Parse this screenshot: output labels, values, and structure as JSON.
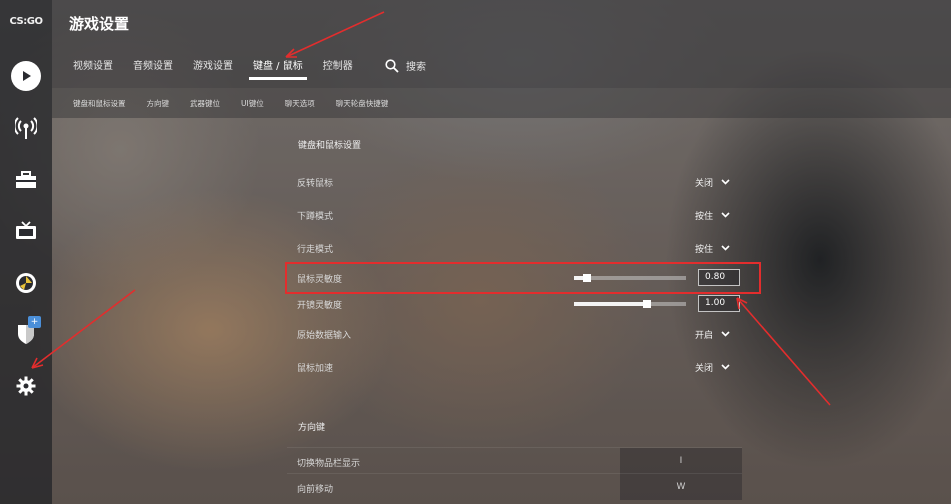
{
  "app": {
    "logo_text": "CS:GO",
    "title": "游戏设置"
  },
  "sidebar": {
    "items": [
      {
        "icon": "play-icon"
      },
      {
        "icon": "broadcast-icon"
      },
      {
        "icon": "briefcase-icon"
      },
      {
        "icon": "tv-icon"
      },
      {
        "icon": "stats-icon"
      },
      {
        "icon": "shield-icon",
        "badge": "+"
      },
      {
        "icon": "gear-icon"
      }
    ]
  },
  "tabs": [
    {
      "label": "视频设置"
    },
    {
      "label": "音频设置"
    },
    {
      "label": "游戏设置"
    },
    {
      "label": "键盘 / 鼠标",
      "active": true
    },
    {
      "label": "控制器"
    }
  ],
  "search": {
    "label": "搜索"
  },
  "subtabs": [
    {
      "label": "键盘和鼠标设置"
    },
    {
      "label": "方向键"
    },
    {
      "label": "武器键位"
    },
    {
      "label": "UI键位"
    },
    {
      "label": "聊天选项"
    },
    {
      "label": "聊天轮盘快捷键"
    }
  ],
  "section1": {
    "title": "键盘和鼠标设置",
    "rows": [
      {
        "label": "反转鼠标",
        "value": "关闭"
      },
      {
        "label": "下蹲模式",
        "value": "按住"
      },
      {
        "label": "行走模式",
        "value": "按住"
      },
      {
        "label": "鼠标灵敏度",
        "value": "0.80",
        "level": 0.12
      },
      {
        "label": "开镜灵敏度",
        "value": "1.00",
        "level": 0.65
      },
      {
        "label": "原始数据输入",
        "value": "开启"
      },
      {
        "label": "鼠标加速",
        "value": "关闭"
      }
    ]
  },
  "section2": {
    "title": "方向键",
    "rows": [
      {
        "label": "切换物品栏显示",
        "key": "I"
      },
      {
        "label": "向前移动",
        "key": "W"
      }
    ]
  },
  "colors": {
    "annotation": "#e32d2d",
    "badge": "#4b8fd9"
  }
}
